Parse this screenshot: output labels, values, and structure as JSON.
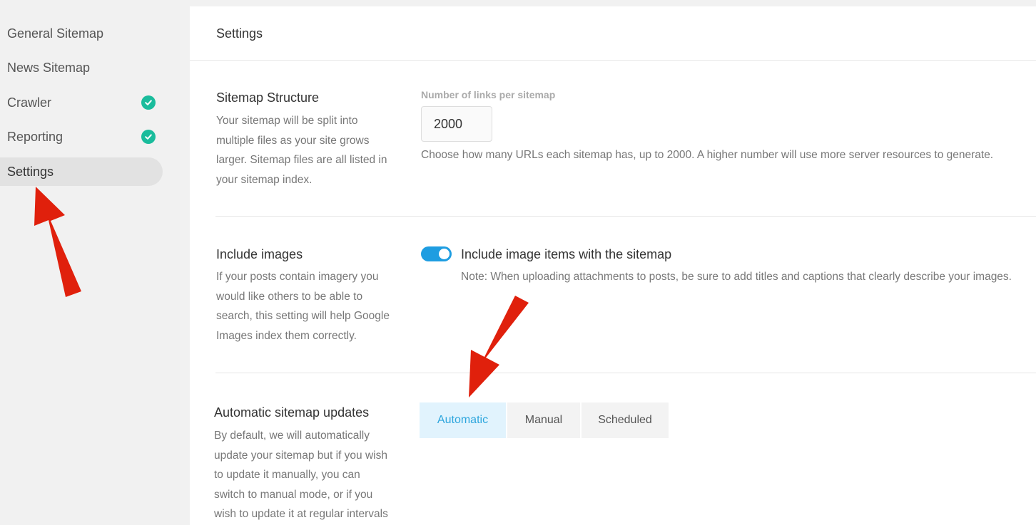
{
  "sidebar": {
    "items": [
      {
        "label": "General Sitemap",
        "checked": false,
        "active": false
      },
      {
        "label": "News Sitemap",
        "checked": false,
        "active": false
      },
      {
        "label": "Crawler",
        "checked": true,
        "active": false
      },
      {
        "label": "Reporting",
        "checked": true,
        "active": false
      },
      {
        "label": "Settings",
        "checked": false,
        "active": true
      }
    ]
  },
  "header": {
    "title": "Settings"
  },
  "sections": {
    "structure": {
      "title": "Sitemap Structure",
      "description": "Your sitemap will be split into multiple files as your site grows larger. Sitemap files are all listed in your sitemap index.",
      "field_label": "Number of links per sitemap",
      "value": "2000",
      "help": "Choose how many URLs each sitemap has, up to 2000. A higher number will use more server resources to generate."
    },
    "images": {
      "title": "Include images",
      "description": "If your posts contain imagery you would like others to be able to search, this setting will help Google Images index them correctly.",
      "toggle_label": "Include image items with the sitemap",
      "toggle_on": true,
      "note": "Note: When uploading attachments to posts, be sure to add titles and captions that clearly describe your images."
    },
    "updates": {
      "title": "Automatic sitemap updates",
      "description": "By default, we will automatically update your sitemap but if you wish to update it manually, you can switch to manual mode, or if you wish to update it at regular intervals",
      "options": [
        "Automatic",
        "Manual",
        "Scheduled"
      ],
      "selected": "Automatic"
    }
  },
  "colors": {
    "accent": "#1e9de1",
    "check": "#1abc9c",
    "arrow": "#e0200c"
  },
  "icons": {
    "check": "check-circle-icon",
    "arrow": "red-arrow-annotation"
  }
}
